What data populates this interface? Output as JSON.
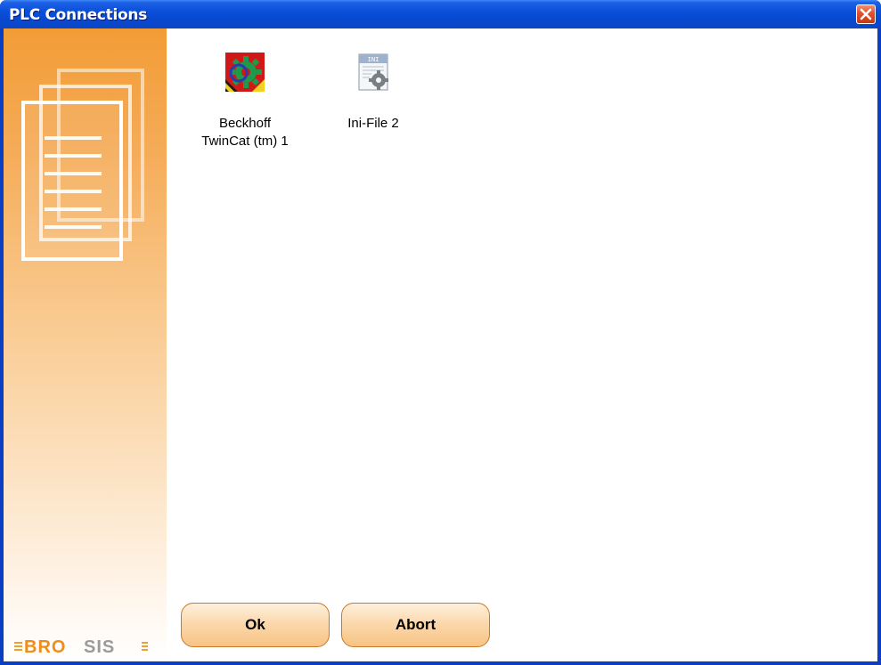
{
  "window": {
    "title": "PLC Connections",
    "close_icon": "close-icon"
  },
  "connections": [
    {
      "label": "Beckhoff\nTwinCat (tm) 1",
      "icon": "beckhoff-twincat-icon"
    },
    {
      "label": "Ini-File 2",
      "icon": "ini-file-icon"
    }
  ],
  "buttons": {
    "ok": "Ok",
    "abort": "Abort"
  },
  "brand": {
    "logo_text_orange": "BRO",
    "logo_text_gray": "SIS"
  },
  "colors": {
    "titlebar": "#0a4fd9",
    "accent_orange": "#f29c36",
    "button_fill": "#fbd9ad",
    "close_red": "#e0502a"
  }
}
